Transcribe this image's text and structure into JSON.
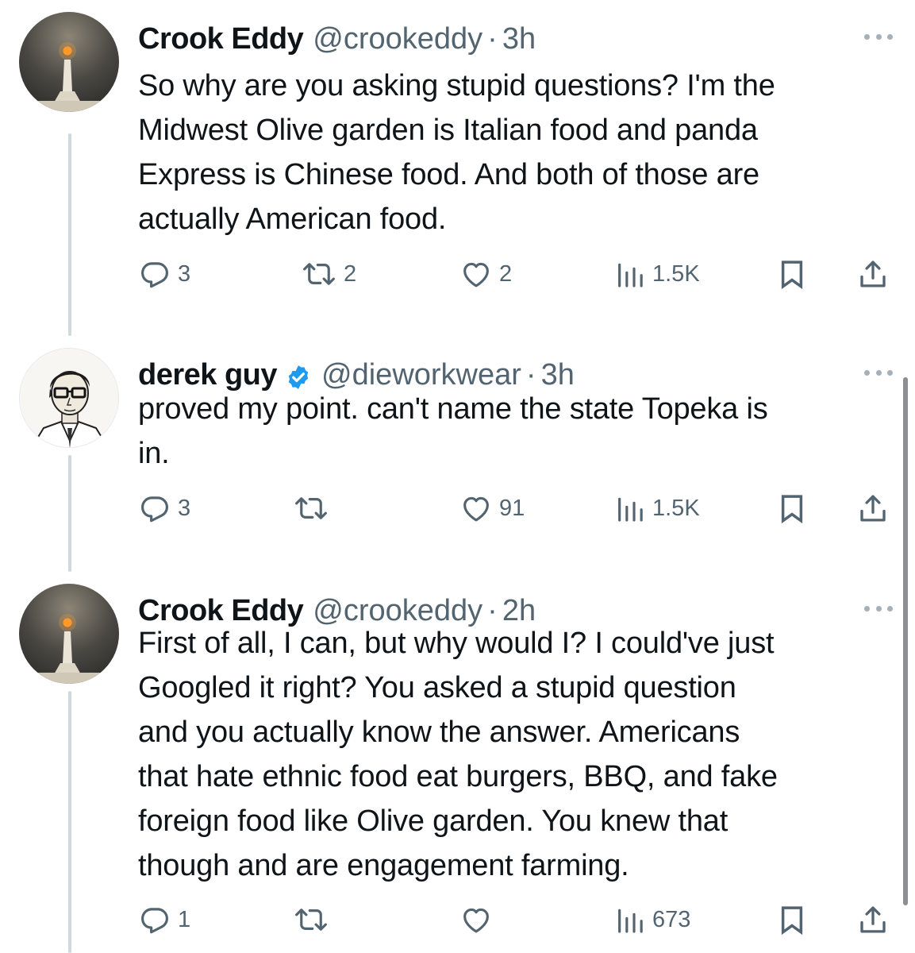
{
  "tweets": [
    {
      "name": "Crook Eddy",
      "handle": "@crookeddy",
      "sep": "·",
      "time": "3h",
      "verified": false,
      "avatar_icon": "lighthouse-sunset-avatar",
      "lines": [
        "So why are you asking stupid questions? I'm the",
        "Midwest Olive garden is Italian food and panda",
        "Express is Chinese food. And both of those are",
        "actually American food."
      ],
      "replies": "3",
      "reposts": "2",
      "likes": "2",
      "views": "1.5K"
    },
    {
      "name": "derek guy",
      "handle": "@dieworkwear",
      "sep": "·",
      "time": "3h",
      "verified": true,
      "avatar_icon": "illustrated-man-glasses-avatar",
      "lines": [
        "proved my point. can't name the state Topeka is",
        "in."
      ],
      "replies": "3",
      "reposts": "",
      "likes": "91",
      "views": "1.5K"
    },
    {
      "name": "Crook Eddy",
      "handle": "@crookeddy",
      "sep": "·",
      "time": "2h",
      "verified": false,
      "avatar_icon": "lighthouse-sunset-avatar",
      "lines": [
        "First of all, I can, but why would I? I could've just",
        "Googled it right? You asked a stupid question",
        "and you actually know the answer. Americans",
        "that hate ethnic food eat burgers, BBQ, and fake",
        "foreign food like Olive garden. You knew that",
        "though and are engagement farming."
      ],
      "replies": "1",
      "reposts": "",
      "likes": "",
      "views": "673"
    }
  ],
  "colors": {
    "text": "#0f1419",
    "muted": "#536471",
    "thread_line": "#cfd9de",
    "verified_blue": "#1d9bf0"
  }
}
